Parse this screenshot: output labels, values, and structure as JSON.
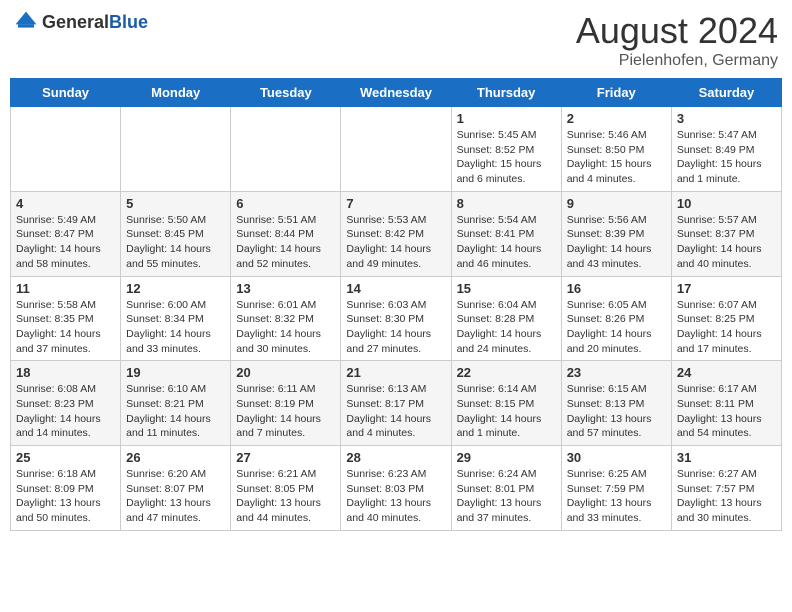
{
  "header": {
    "logo_general": "General",
    "logo_blue": "Blue",
    "month_year": "August 2024",
    "location": "Pielenhofen, Germany"
  },
  "weekdays": [
    "Sunday",
    "Monday",
    "Tuesday",
    "Wednesday",
    "Thursday",
    "Friday",
    "Saturday"
  ],
  "weeks": [
    [
      {
        "day": "",
        "info": ""
      },
      {
        "day": "",
        "info": ""
      },
      {
        "day": "",
        "info": ""
      },
      {
        "day": "",
        "info": ""
      },
      {
        "day": "1",
        "info": "Sunrise: 5:45 AM\nSunset: 8:52 PM\nDaylight: 15 hours\nand 6 minutes."
      },
      {
        "day": "2",
        "info": "Sunrise: 5:46 AM\nSunset: 8:50 PM\nDaylight: 15 hours\nand 4 minutes."
      },
      {
        "day": "3",
        "info": "Sunrise: 5:47 AM\nSunset: 8:49 PM\nDaylight: 15 hours\nand 1 minute."
      }
    ],
    [
      {
        "day": "4",
        "info": "Sunrise: 5:49 AM\nSunset: 8:47 PM\nDaylight: 14 hours\nand 58 minutes."
      },
      {
        "day": "5",
        "info": "Sunrise: 5:50 AM\nSunset: 8:45 PM\nDaylight: 14 hours\nand 55 minutes."
      },
      {
        "day": "6",
        "info": "Sunrise: 5:51 AM\nSunset: 8:44 PM\nDaylight: 14 hours\nand 52 minutes."
      },
      {
        "day": "7",
        "info": "Sunrise: 5:53 AM\nSunset: 8:42 PM\nDaylight: 14 hours\nand 49 minutes."
      },
      {
        "day": "8",
        "info": "Sunrise: 5:54 AM\nSunset: 8:41 PM\nDaylight: 14 hours\nand 46 minutes."
      },
      {
        "day": "9",
        "info": "Sunrise: 5:56 AM\nSunset: 8:39 PM\nDaylight: 14 hours\nand 43 minutes."
      },
      {
        "day": "10",
        "info": "Sunrise: 5:57 AM\nSunset: 8:37 PM\nDaylight: 14 hours\nand 40 minutes."
      }
    ],
    [
      {
        "day": "11",
        "info": "Sunrise: 5:58 AM\nSunset: 8:35 PM\nDaylight: 14 hours\nand 37 minutes."
      },
      {
        "day": "12",
        "info": "Sunrise: 6:00 AM\nSunset: 8:34 PM\nDaylight: 14 hours\nand 33 minutes."
      },
      {
        "day": "13",
        "info": "Sunrise: 6:01 AM\nSunset: 8:32 PM\nDaylight: 14 hours\nand 30 minutes."
      },
      {
        "day": "14",
        "info": "Sunrise: 6:03 AM\nSunset: 8:30 PM\nDaylight: 14 hours\nand 27 minutes."
      },
      {
        "day": "15",
        "info": "Sunrise: 6:04 AM\nSunset: 8:28 PM\nDaylight: 14 hours\nand 24 minutes."
      },
      {
        "day": "16",
        "info": "Sunrise: 6:05 AM\nSunset: 8:26 PM\nDaylight: 14 hours\nand 20 minutes."
      },
      {
        "day": "17",
        "info": "Sunrise: 6:07 AM\nSunset: 8:25 PM\nDaylight: 14 hours\nand 17 minutes."
      }
    ],
    [
      {
        "day": "18",
        "info": "Sunrise: 6:08 AM\nSunset: 8:23 PM\nDaylight: 14 hours\nand 14 minutes."
      },
      {
        "day": "19",
        "info": "Sunrise: 6:10 AM\nSunset: 8:21 PM\nDaylight: 14 hours\nand 11 minutes."
      },
      {
        "day": "20",
        "info": "Sunrise: 6:11 AM\nSunset: 8:19 PM\nDaylight: 14 hours\nand 7 minutes."
      },
      {
        "day": "21",
        "info": "Sunrise: 6:13 AM\nSunset: 8:17 PM\nDaylight: 14 hours\nand 4 minutes."
      },
      {
        "day": "22",
        "info": "Sunrise: 6:14 AM\nSunset: 8:15 PM\nDaylight: 14 hours\nand 1 minute."
      },
      {
        "day": "23",
        "info": "Sunrise: 6:15 AM\nSunset: 8:13 PM\nDaylight: 13 hours\nand 57 minutes."
      },
      {
        "day": "24",
        "info": "Sunrise: 6:17 AM\nSunset: 8:11 PM\nDaylight: 13 hours\nand 54 minutes."
      }
    ],
    [
      {
        "day": "25",
        "info": "Sunrise: 6:18 AM\nSunset: 8:09 PM\nDaylight: 13 hours\nand 50 minutes."
      },
      {
        "day": "26",
        "info": "Sunrise: 6:20 AM\nSunset: 8:07 PM\nDaylight: 13 hours\nand 47 minutes."
      },
      {
        "day": "27",
        "info": "Sunrise: 6:21 AM\nSunset: 8:05 PM\nDaylight: 13 hours\nand 44 minutes."
      },
      {
        "day": "28",
        "info": "Sunrise: 6:23 AM\nSunset: 8:03 PM\nDaylight: 13 hours\nand 40 minutes."
      },
      {
        "day": "29",
        "info": "Sunrise: 6:24 AM\nSunset: 8:01 PM\nDaylight: 13 hours\nand 37 minutes."
      },
      {
        "day": "30",
        "info": "Sunrise: 6:25 AM\nSunset: 7:59 PM\nDaylight: 13 hours\nand 33 minutes."
      },
      {
        "day": "31",
        "info": "Sunrise: 6:27 AM\nSunset: 7:57 PM\nDaylight: 13 hours\nand 30 minutes."
      }
    ]
  ]
}
